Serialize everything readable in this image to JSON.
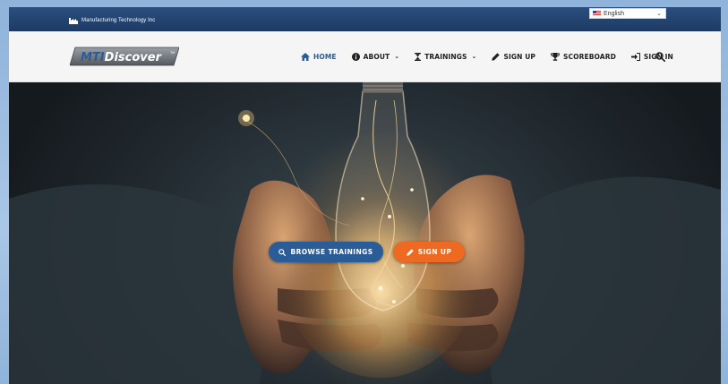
{
  "topbar": {
    "company": "Manufacturing Technology Inc",
    "language": "English",
    "icons": {
      "company": "factory-icon",
      "flag": "us-flag-icon",
      "dropdown": "chevron-down-icon"
    }
  },
  "logo": {
    "text": "MTIDiscover",
    "mark": "TM"
  },
  "nav": {
    "home": "HOME",
    "about": "ABOUT",
    "trainings": "TRAININGS",
    "signup": "SIGN UP",
    "scoreboard": "SCOREBOARD",
    "signin": "SIGN IN",
    "icons": {
      "home": "home-icon",
      "about": "info-circle-icon",
      "trainings": "hourglass-icon",
      "signup": "pencil-icon",
      "scoreboard": "trophy-icon",
      "signin": "sign-in-icon",
      "search": "search-icon"
    }
  },
  "hero": {
    "browse_label": "BROWSE TRAININGS",
    "signup_label": "SIGN UP"
  },
  "colors": {
    "topbar": "#1d3a63",
    "nav_active": "#2a5d98",
    "browse_button": "#2a5d98",
    "signup_button": "#ee6a22"
  }
}
